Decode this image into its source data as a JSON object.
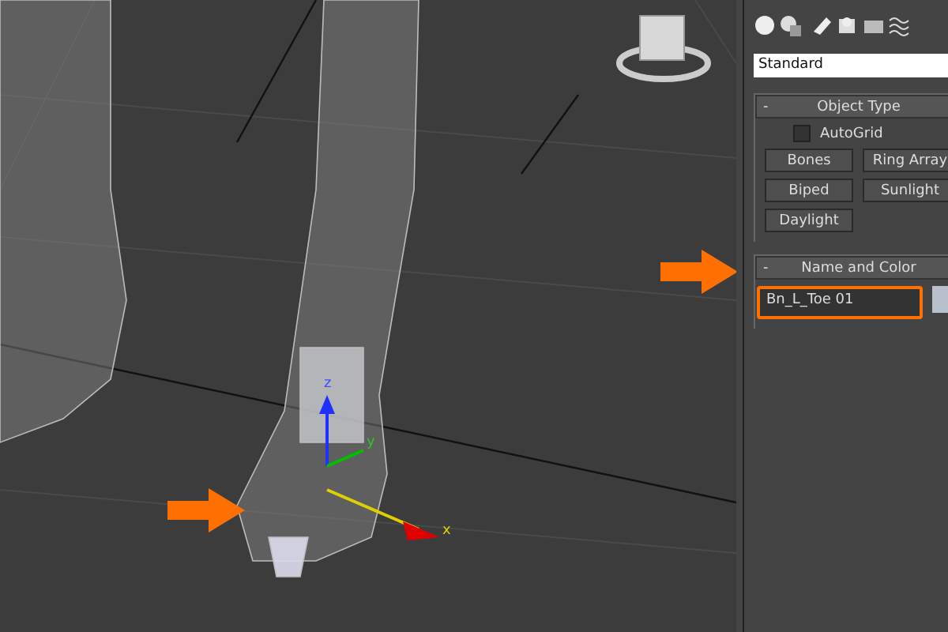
{
  "viewport": {
    "axis_labels": [
      "z",
      "y",
      "x"
    ]
  },
  "command_panel": {
    "dropdown": {
      "value": "Standard"
    },
    "object_type": {
      "title": "Object Type",
      "collapse": "-",
      "autogrid": {
        "label": "AutoGrid",
        "checked": false
      },
      "buttons": [
        "Bones",
        "Ring Array",
        "Biped",
        "Sunlight",
        "Daylight"
      ]
    },
    "name_and_color": {
      "title": "Name and Color",
      "collapse": "-",
      "name_field": {
        "value": "Bn_L_Toe 01",
        "highlighted": true
      }
    }
  }
}
